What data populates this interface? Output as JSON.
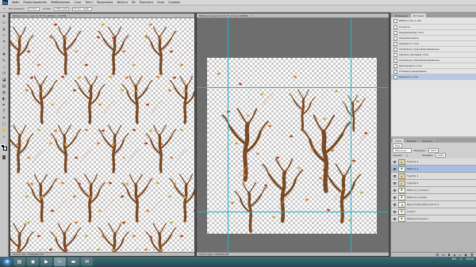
{
  "app": {
    "logo": "Ps"
  },
  "menu": [
    "Файл",
    "Редактирование",
    "Изображение",
    "Слои",
    "Текст",
    "Выделение",
    "Фильтр",
    "3D",
    "Просмотр",
    "Окно",
    "Справка"
  ],
  "options": {
    "feather_label": "Растушевка:",
    "feather_value": "0 пикс.",
    "style_label": "Стиль:",
    "style_value": "Обычный",
    "refine": "Уточн. край..."
  },
  "doc_left": {
    "tab": "Pattern_tree_1.psd @ 33.3% (Pattern, RGB/8)",
    "status": "33,33%   Док: 8,58M/200,7M"
  },
  "doc_right": {
    "tab": "Pattern_tree.psd @ 16.7% (Слой, RGB/8)",
    "status": "16,67%   Док: 16,8M/78,4M"
  },
  "history": {
    "tabs": [
      "Операции",
      "История"
    ],
    "active_tab": "История",
    "snapshot": "Pattern_tree_1.psd",
    "steps": [
      "Открыть",
      "Перемещение слоя",
      "Переименовать",
      "Перевести слои",
      "Свободное трансформирование",
      "Удалить фоновый слой",
      "Свободное трансформирование",
      "Дублировать слои",
      "Отменить выделение",
      "Выделить слои"
    ],
    "selected": 9
  },
  "layers": {
    "tabs": [
      "Слои",
      "Каналы",
      "Контуры"
    ],
    "kind": "Вид",
    "blend": "Обычные",
    "opacity_label": "Непрозр.:",
    "opacity": "100%",
    "lock_label": "Закреп.:",
    "fill_label": "Заливка:",
    "fill": "100%",
    "rows": [
      {
        "name": "Группа 3",
        "type": "group",
        "sel": false
      },
      {
        "name": "Работа_1",
        "type": "layer",
        "sel": true
      },
      {
        "name": "Группа 1",
        "type": "group",
        "sel": false
      },
      {
        "name": "Группа 2",
        "type": "group",
        "sel": false
      },
      {
        "name": "Работа_1 копия 3",
        "type": "layer",
        "sel": false
      },
      {
        "name": "Работа_1 копия",
        "type": "layer",
        "sel": false
      },
      {
        "name": "Яркость/Контрастность 1",
        "type": "adj",
        "sel": false
      },
      {
        "name": "Слой 1",
        "type": "layer",
        "sel": false
      },
      {
        "name": "Прямоугольник 1",
        "type": "layer",
        "sel": false
      }
    ]
  },
  "taskbar": {
    "items": [
      "start",
      "explorer",
      "browser",
      "media",
      "photoshop",
      "folder",
      "mail"
    ],
    "lang": "RU",
    "time": "16:24"
  },
  "colors": {
    "tree_trunk": "#7a4a22",
    "leaf_orange": "#d9822b",
    "leaf_yellow": "#c9b043",
    "leaf_red": "#b5431e",
    "guide": "#23b3c9"
  }
}
